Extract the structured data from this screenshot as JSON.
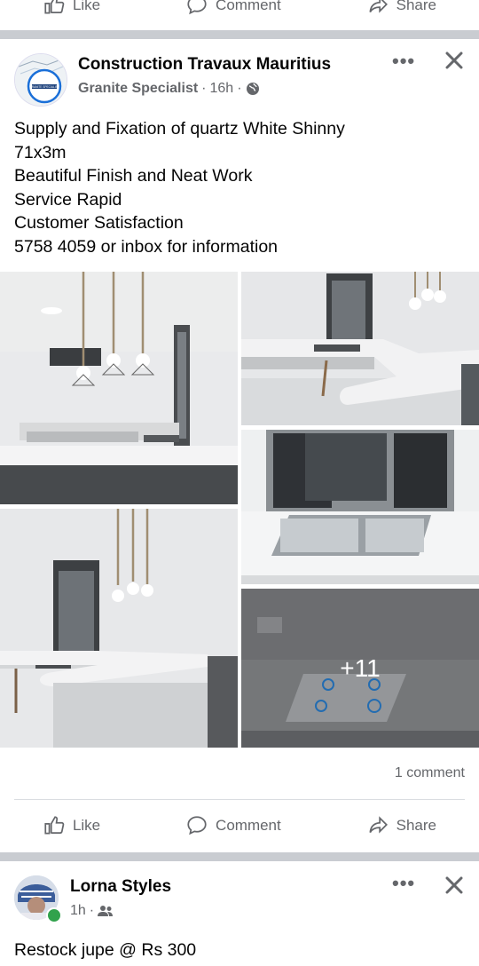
{
  "top_actions": {
    "like": "Like",
    "comment": "Comment",
    "share": "Share"
  },
  "post1": {
    "page_name": "Construction Travaux Mauritius",
    "category": "Granite Specialist",
    "time": "16h",
    "avatar_text": "GRANITE SPECIALIST",
    "text_lines": [
      "Supply and Fixation of quartz White Shinny",
      "71x3m",
      "Beautiful Finish and Neat Work",
      "Service Rapid",
      "Customer Satisfaction",
      "5758 4059 or inbox for information"
    ],
    "more_photos": "+11",
    "comment_count": "1 comment",
    "actions": {
      "like": "Like",
      "comment": "Comment",
      "share": "Share"
    }
  },
  "post2": {
    "name": "Lorna Styles",
    "time": "1h",
    "text": "Restock jupe @ Rs 300"
  },
  "icons": {
    "more": "more-icon",
    "close": "close-icon",
    "globe": "globe-icon",
    "friends": "friends-icon"
  },
  "colors": {
    "accent": "#1877f2",
    "secondary_text": "#65676b",
    "online": "#31a24c"
  }
}
